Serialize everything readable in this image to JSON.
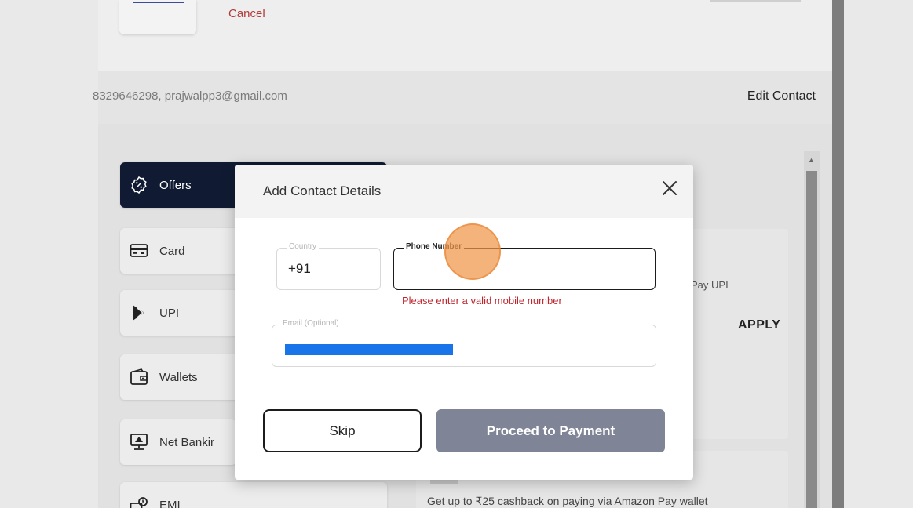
{
  "header": {
    "cancel_label": "Cancel"
  },
  "contact": {
    "info": "8329646298, prajwalpp3@gmail.com",
    "edit_label": "Edit Contact"
  },
  "methods": [
    {
      "label": "Offers",
      "icon": "percent-badge-icon",
      "active": true
    },
    {
      "label": "Card",
      "icon": "card-icon",
      "active": false
    },
    {
      "label": "UPI",
      "icon": "upi-icon",
      "active": false
    },
    {
      "label": "Wallets",
      "icon": "wallet-icon",
      "active": false
    },
    {
      "label": "Net Bankir",
      "icon": "net-banking-icon",
      "active": false
    },
    {
      "label": "EMI",
      "icon": "emi-icon",
      "active": false
    }
  ],
  "offers": {
    "pay_upi_text": "Pay UPI",
    "apply_label": "APPLY",
    "cashback_text": "Get up to ₹25 cashback on paying via Amazon Pay wallet"
  },
  "modal": {
    "title": "Add Contact Details",
    "country_legend": "Country",
    "country_value": "+91",
    "phone_legend": "Phone Number",
    "phone_value": "",
    "error_text": "Please enter a valid mobile number",
    "email_legend": "Email (Optional)",
    "skip_label": "Skip",
    "proceed_label": "Proceed to Payment"
  },
  "colors": {
    "active_method_bg": "#101b33",
    "error": "#c0262d",
    "proceed_bg": "#7f8496",
    "cancel_link": "#b23a3a"
  }
}
